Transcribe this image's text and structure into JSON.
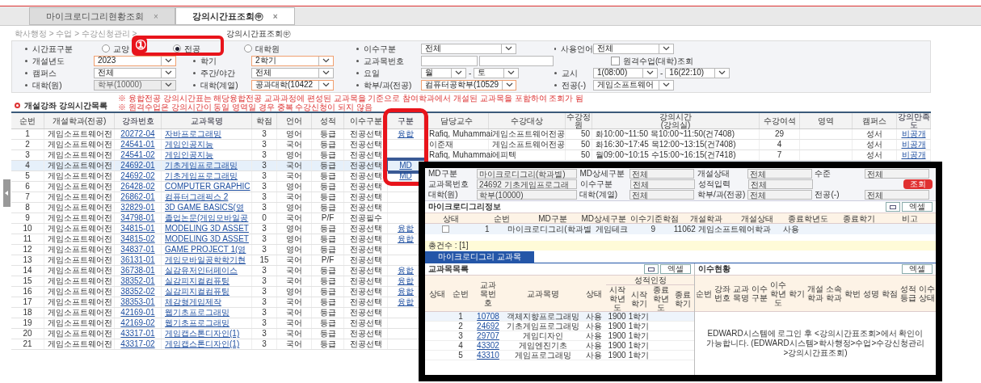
{
  "tabs": [
    {
      "label": "마이크로디그리현황조회",
      "close": "×",
      "selected": false
    },
    {
      "label": "강의시간표조회㊥",
      "close": "×",
      "selected": true
    }
  ],
  "breadcrumb": "학사행정 > 수업 > 수강신청관리 >",
  "page_title": "강의시간표조회㊥",
  "filters": [
    [
      {
        "label": "시간표구분",
        "kind": "radio",
        "options": [
          {
            "label": "교양",
            "selected": false
          },
          {
            "label": "전공",
            "selected": true
          },
          {
            "label": "대학원",
            "selected": false
          }
        ]
      },
      {
        "label": "이수구분",
        "kind": "select",
        "value": "전체",
        "required": false,
        "disabled": false
      },
      {
        "label": "사용언어",
        "kind": "select",
        "value": "전체",
        "required": false,
        "disabled": false
      }
    ],
    [
      {
        "label": "개설년도",
        "kind": "select",
        "value": "2023",
        "required": true,
        "disabled": false
      },
      {
        "label": "학기",
        "kind": "select",
        "value": "2학기",
        "required": true,
        "disabled": false
      },
      {
        "label": "교과목번호",
        "kind": "text"
      },
      {
        "kind": "checkbox",
        "text": "원격수업(대학)조회",
        "checked": false
      }
    ],
    [
      {
        "label": "캠퍼스",
        "kind": "select",
        "value": "전체",
        "required": false,
        "disabled": false
      },
      {
        "label": "주간/야간",
        "kind": "select",
        "value": "전체",
        "required": false,
        "disabled": false
      },
      {
        "label": "요일",
        "kind": "range",
        "from": "월",
        "to": "토",
        "sep": "-"
      },
      {
        "label": "교시",
        "kind": "range",
        "from": "1(08:00)",
        "to": "16(22:10)",
        "sep": "-"
      }
    ],
    [
      {
        "label": "대학(원)",
        "kind": "select",
        "value": "학부(10000)",
        "required": false,
        "disabled": true
      },
      {
        "label": "대학(계열)",
        "kind": "select",
        "value": "공과대학(10422",
        "required": true,
        "disabled": false
      },
      {
        "label": "학부/과(전공)",
        "kind": "select",
        "value": "컴퓨터공학부(10529",
        "required": true,
        "disabled": false
      },
      {
        "label": "전공(-)",
        "kind": "select",
        "value": "게임소프트웨어",
        "required": false,
        "disabled": false
      }
    ]
  ],
  "section_title": "개설강좌 강의시간목록",
  "notes": [
    "※ 융합전공 강의시간표는 해당융합전공 교과과정에 편성된 교과목을 기준으로 참여학과에서 개설된 교과목을 포함하여 조회가 됨",
    "※ 원격수업은 강의시간이 동일 영역일 경우 중복 수강신청이 되지 않음"
  ],
  "table": {
    "columns": [
      {
        "label": "순번",
        "link": false
      },
      {
        "label": "개설학과(전공)",
        "link": false
      },
      {
        "label": "강좌번호",
        "link": true
      },
      {
        "label": "교과목명",
        "link": true
      },
      {
        "label": "학점",
        "link": false
      },
      {
        "label": "언어",
        "link": false
      },
      {
        "label": "성적",
        "link": false
      },
      {
        "label": "이수구분",
        "link": false
      },
      {
        "label": "구분",
        "link": true
      },
      {
        "label": "담당교수",
        "link": false
      },
      {
        "label": "수강대상",
        "link": false
      },
      {
        "label": "수강정원",
        "link": false
      },
      {
        "label": "강의시간\n(강의실)",
        "link": false
      },
      {
        "label": "수강여석",
        "link": false
      },
      {
        "label": "영역",
        "link": false
      },
      {
        "label": "캠퍼스",
        "link": false
      },
      {
        "label": "강의만족도",
        "link": true
      }
    ],
    "rows": [
      {
        "selected": false,
        "cells": [
          "1",
          "게임소프트웨어전",
          "20272-04",
          "자바프로그래밍",
          "3",
          "영어",
          "등급",
          "전공선택",
          "융합",
          "Rafiq, Muhammai",
          "게임소프트웨어전공",
          "50",
          "화10:00~11:50 목10:00~11:50(건7408)",
          "29",
          null,
          "성서",
          "비공개"
        ]
      },
      {
        "selected": false,
        "cells": [
          "2",
          "게임소프트웨어전",
          "24541-01",
          "게임인공지능",
          "3",
          "국어",
          "등급",
          "전공선택",
          null,
          "이준재",
          "게임소프트웨어전공",
          "50",
          "화16:30~17:45 목12:00~13:15(건7408)",
          "4",
          null,
          "성서",
          "비공개"
        ]
      },
      {
        "selected": false,
        "cells": [
          "3",
          "게임소프트웨어전",
          "24541-02",
          "게임인공지능",
          "3",
          "영어",
          "등급",
          "전공선택",
          null,
          "Rafiq, Muhammai",
          "에피텍",
          "50",
          "월09:00~10:15 수15:00~16:15(건7418)",
          "7",
          null,
          "성서",
          "비공개"
        ]
      },
      {
        "selected": true,
        "cells": [
          "4",
          "게임소프트웨어전",
          "24692-01",
          "기초게임프로그래밍",
          "3",
          "국어",
          "등급",
          "전공선택",
          "MD"
        ]
      },
      {
        "selected": false,
        "cells": [
          "5",
          "게임소프트웨어전",
          "24692-02",
          "기초게임프로그래밍",
          "3",
          "국어",
          "등급",
          "전공선택",
          "MD"
        ]
      },
      {
        "selected": false,
        "cells": [
          "6",
          "게임소프트웨어전",
          "26428-02",
          "COMPUTER GRAPHIC",
          "3",
          "영어",
          "등급",
          "전공선택",
          null
        ]
      },
      {
        "selected": false,
        "cells": [
          "7",
          "게임소프트웨어전",
          "26862-01",
          "컴퓨터그래픽스 2",
          "3",
          "국어",
          "등급",
          "전공선택",
          null
        ]
      },
      {
        "selected": false,
        "cells": [
          "8",
          "게임소프트웨어전",
          "32829-01",
          "3D GAME BASICS(영",
          "3",
          "영어",
          "등급",
          "전공선택",
          null
        ]
      },
      {
        "selected": false,
        "cells": [
          "9",
          "게임소프트웨어전",
          "34798-01",
          "졸업논문(게임모바일공",
          "0",
          "국어",
          "P/F",
          "전공필수",
          null
        ]
      },
      {
        "selected": false,
        "cells": [
          "10",
          "게임소프트웨어전",
          "34815-01",
          "MODELING 3D ASSET",
          "3",
          "영어",
          "등급",
          "전공선택",
          "융합"
        ]
      },
      {
        "selected": false,
        "cells": [
          "11",
          "게임소프트웨어전",
          "34815-02",
          "MODELING 3D ASSET",
          "3",
          "영어",
          "등급",
          "전공선택",
          "융합"
        ]
      },
      {
        "selected": false,
        "cells": [
          "12",
          "게임소프트웨어전",
          "34837-01",
          "GAME PROJECT 1(영",
          "3",
          "영어",
          "등급",
          "전공선택",
          null
        ]
      },
      {
        "selected": false,
        "cells": [
          "13",
          "게임소프트웨어전",
          "36131-01",
          "게임모바일공학학기현",
          "15",
          "국어",
          "P/F",
          "전공선택",
          null
        ]
      },
      {
        "selected": false,
        "cells": [
          "14",
          "게임소프트웨어전",
          "36738-01",
          "실감유저인터페이스",
          "3",
          "국어",
          "등급",
          "전공선택",
          "융합"
        ]
      },
      {
        "selected": false,
        "cells": [
          "15",
          "게임소프트웨어전",
          "38352-01",
          "실감피지컬컴퓨팅",
          "3",
          "국어",
          "등급",
          "전공선택",
          "융합"
        ]
      },
      {
        "selected": false,
        "cells": [
          "16",
          "게임소프트웨어전",
          "38352-02",
          "실감피지컬컴퓨팅",
          "3",
          "영어",
          "등급",
          "전공선택",
          "융합"
        ]
      },
      {
        "selected": false,
        "cells": [
          "17",
          "게임소프트웨어전",
          "38353-01",
          "체감형게임제작",
          "3",
          "국어",
          "등급",
          "전공선택",
          "융합"
        ]
      },
      {
        "selected": false,
        "cells": [
          "18",
          "게임소프트웨어전",
          "42169-01",
          "웹기초프로그래밍",
          "3",
          "국어",
          "등급",
          "전공선택",
          null
        ]
      },
      {
        "selected": false,
        "cells": [
          "19",
          "게임소프트웨어전",
          "42169-02",
          "웹기초프로그래밍",
          "3",
          "국어",
          "등급",
          "전공선택",
          null
        ]
      },
      {
        "selected": false,
        "cells": [
          "20",
          "게임소프트웨어전",
          "43317-01",
          "게임캡스톤디자인(1)",
          "3",
          "국어",
          "등급",
          "전공선택",
          null
        ]
      },
      {
        "selected": false,
        "cells": [
          "21",
          "게임소프트웨어전",
          "43317-02",
          "게임캡스톤디자인(1)",
          "3",
          "국어",
          "등급",
          "전공선택",
          null
        ]
      }
    ]
  },
  "annotation": {
    "label": "①"
  },
  "inset": {
    "filters": [
      [
        {
          "label": "MD구분",
          "value": "마이크로디그리(학과별)"
        },
        {
          "label": "MD상세구분",
          "value": "전체"
        },
        {
          "label": "개설상태",
          "value": "전체"
        },
        {
          "label": "수준",
          "value": "전체"
        }
      ],
      [
        {
          "label": "교과목번호",
          "value": "24692 기초게임프로그래"
        },
        {
          "label": "이수구분",
          "value": "전체"
        },
        {
          "label": "성적입력",
          "value": "전체"
        }
      ],
      [
        {
          "label": "대학(원)",
          "value": "학부(10000)"
        },
        {
          "label": "대학(계열)",
          "value": "전체"
        },
        {
          "label": "학부/과(전공)",
          "value": "전체"
        },
        {
          "label": "전공(-)",
          "value": "전체"
        }
      ]
    ],
    "search_button": "조회",
    "md_title": "마이크로디그리정보",
    "md_excel": "엑셀",
    "md_columns": [
      "상태",
      "순번",
      "MD구분",
      "MD상세구분",
      "이수기준학점",
      "개설학과",
      "개설상태",
      "종료학년도",
      "종료학기",
      "비고"
    ],
    "md_rows": [
      {
        "checked": false,
        "cells": [
          null,
          "1",
          "마이크로디그리(학과별",
          "게임테크",
          "9",
          "11062 게임소프트웨어학과",
          "사용",
          null,
          null,
          null
        ]
      }
    ],
    "md_total": "총건수 : [1]",
    "tab": "마이크로디그리 교과목",
    "course_title": "교과목목록",
    "course_excel": "엑셀",
    "course_columns": [
      "상태",
      "순번",
      "교과목번호",
      "교과목명",
      "상태",
      "시작학년도",
      "시작학기",
      "종료학년도",
      "종료학기"
    ],
    "course_group": "성적인정",
    "course_rows": [
      [
        "1",
        "10708",
        "객체지향프로그래밍",
        "사용",
        "1900",
        "1학기"
      ],
      [
        "2",
        "24692",
        "기초게임프로그래밍",
        "사용",
        "1900",
        "1학기"
      ],
      [
        "3",
        "29707",
        "게임디자인",
        "사용",
        "1900",
        "1학기"
      ],
      [
        "4",
        "43302",
        "게임엔진기초",
        "사용",
        "1900",
        "1학기"
      ],
      [
        "5",
        "43310",
        "게임프로그래밍",
        "사용",
        "1900",
        "1학기"
      ]
    ],
    "status_title": "이수현황",
    "status_excel": "엑셀",
    "status_columns": [
      "순번",
      "강좌번호",
      "교과목명",
      "이수구분",
      "이수학년도",
      "학기",
      "개설학과",
      "소속학과",
      "학번",
      "성명",
      "학점",
      "성적등급",
      "이수상태"
    ],
    "status_message": "EDWARD시스템에 로그인 후 <강의시간표조회>에서 확인이 가능합니다. (EDWARD시스템>학사행정>수업>수강신청관리>강의시간표조회)"
  }
}
